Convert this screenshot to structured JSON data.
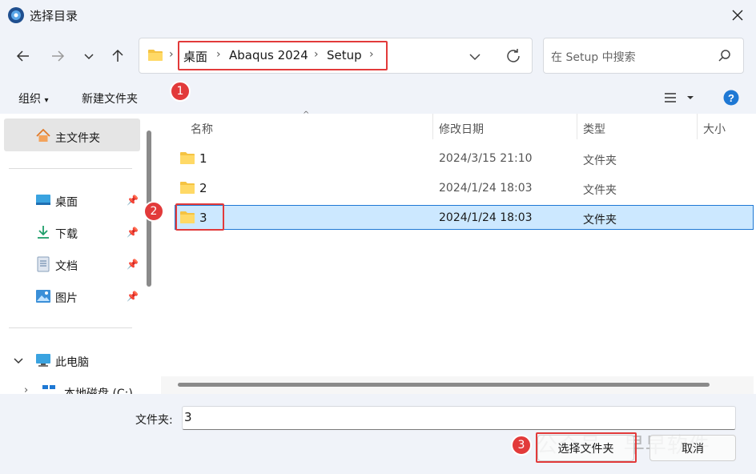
{
  "window": {
    "title": "选择目录"
  },
  "address": {
    "crumbs": [
      "桌面",
      "Abaqus 2024",
      "Setup"
    ]
  },
  "search": {
    "placeholder": "在 Setup 中搜索"
  },
  "toolbar": {
    "organize": "组织",
    "new_folder": "新建文件夹"
  },
  "annotations": [
    "1",
    "2",
    "3"
  ],
  "sidebar": {
    "home": "主文件夹",
    "quick": [
      {
        "label": "桌面",
        "icon": "desktop-icon"
      },
      {
        "label": "下载",
        "icon": "download-icon"
      },
      {
        "label": "文档",
        "icon": "document-icon"
      },
      {
        "label": "图片",
        "icon": "picture-icon"
      }
    ],
    "this_pc": "此电脑",
    "drive_partial": "本地磁盘 (C:)"
  },
  "columns": {
    "name": "名称",
    "modified": "修改日期",
    "type": "类型",
    "size": "大小"
  },
  "files": [
    {
      "name": "1",
      "modified": "2024/3/15 21:10",
      "type": "文件夹"
    },
    {
      "name": "2",
      "modified": "2024/1/24 18:03",
      "type": "文件夹"
    },
    {
      "name": "3",
      "modified": "2024/1/24 18:03",
      "type": "文件夹"
    }
  ],
  "footer": {
    "folder_label": "文件夹:",
    "folder_value": "3",
    "select_button": "选择文件夹",
    "cancel_button": "取消",
    "watermark": "公众号 · 早早软件"
  },
  "colors": {
    "accent": "#1e78d4",
    "selection": "#cce8ff",
    "annotation": "#e23a3a",
    "folder": "#f5c342"
  }
}
